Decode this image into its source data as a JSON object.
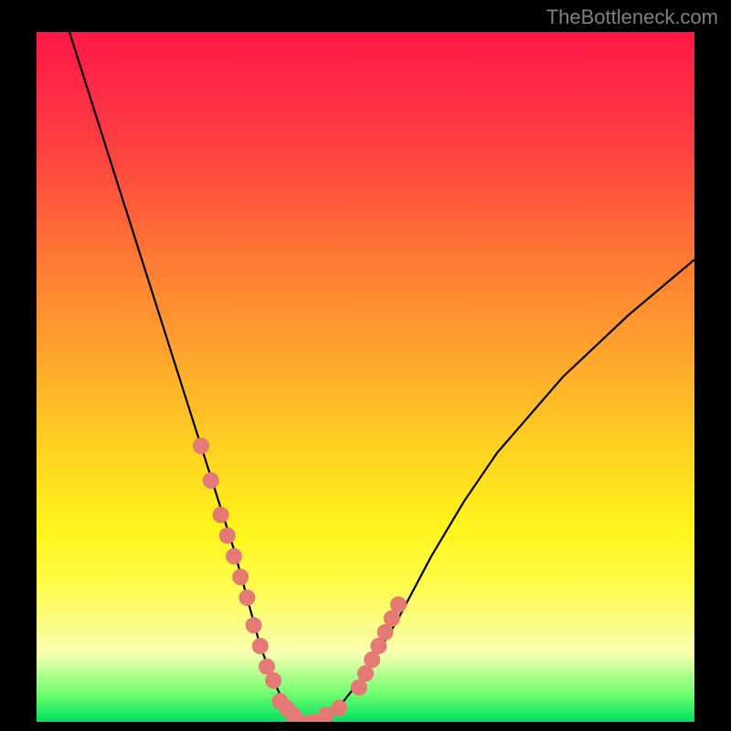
{
  "watermark": "TheBottleneck.com",
  "chart_data": {
    "type": "line",
    "title": "",
    "xlabel": "",
    "ylabel": "",
    "xlim": [
      0,
      100
    ],
    "ylim": [
      0,
      100
    ],
    "legend": false,
    "grid": false,
    "background_gradient": {
      "stops": [
        {
          "pos": 0.0,
          "color": "#ff1846"
        },
        {
          "pos": 0.2,
          "color": "#ff4a3e"
        },
        {
          "pos": 0.47,
          "color": "#ffa62d"
        },
        {
          "pos": 0.72,
          "color": "#fff51a"
        },
        {
          "pos": 0.9,
          "color": "#f9ffb0"
        },
        {
          "pos": 1.0,
          "color": "#00e060"
        }
      ]
    },
    "series": [
      {
        "name": "bottleneck-curve",
        "type": "line",
        "color": "#000000",
        "x": [
          5,
          10,
          15,
          20,
          25,
          28,
          30,
          32,
          34,
          36,
          38,
          40,
          45,
          50,
          55,
          60,
          65,
          70,
          80,
          90,
          100
        ],
        "y": [
          100,
          85,
          70,
          55,
          40,
          31,
          25,
          18,
          11,
          6,
          2,
          0,
          1,
          7,
          15,
          24,
          32,
          39,
          50,
          59,
          67
        ]
      },
      {
        "name": "highlight-markers",
        "type": "scatter",
        "color": "#e47a73",
        "x": [
          25,
          26.5,
          28,
          29,
          30,
          31,
          32,
          33,
          34,
          35,
          36,
          37,
          38,
          39,
          40,
          42,
          44,
          46,
          49,
          50,
          51,
          52,
          53,
          54,
          55
        ],
        "y": [
          40,
          35,
          30,
          27,
          24,
          21,
          18,
          14,
          11,
          8,
          6,
          3,
          2,
          1,
          0,
          0,
          1,
          2,
          5,
          7,
          9,
          11,
          13,
          15,
          17
        ]
      }
    ],
    "annotations": []
  }
}
